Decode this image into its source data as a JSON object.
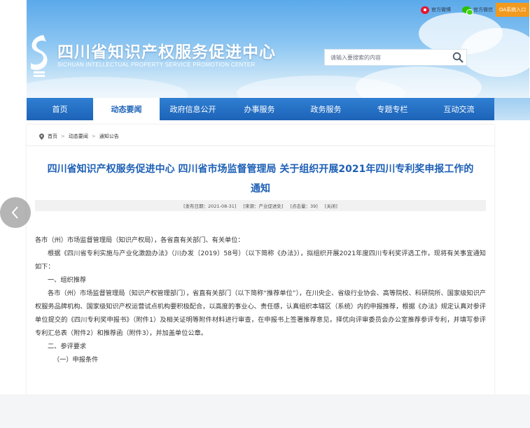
{
  "header": {
    "weibo_label": "官方微博",
    "wechat_label": "官方微信",
    "oa_label": "OA系统入口",
    "site_title": "四川省知识产权服务促进中心",
    "site_subtitle": "SICHUAN INTELLECTUAL PROPERTY SERVICE PROMOTION CENTER",
    "search_placeholder": "请输入要搜索的内容"
  },
  "nav": {
    "items": [
      {
        "label": "首页"
      },
      {
        "label": "动态要闻"
      },
      {
        "label": "政府信息公开"
      },
      {
        "label": "办事服务"
      },
      {
        "label": "政务服务"
      },
      {
        "label": "专题专栏"
      },
      {
        "label": "互动交流"
      }
    ],
    "active_index": 1
  },
  "breadcrumb": {
    "items": [
      "首页",
      "动态要闻",
      "通知公告"
    ],
    "separator": ">"
  },
  "article": {
    "title_line1": "四川省知识产权服务促进中心 四川省市场监督管理局 关于组织开展2021年四川专利奖申报工作的",
    "title_line2": "通知",
    "meta": {
      "date": "[发布日期：2021-08-31]",
      "source": "[来源：产业促进处]",
      "clicks": "[点击量：39]",
      "close": "[关闭]"
    },
    "paragraphs": [
      "各市（州）市场监督管理局（知识产权局），各省直有关部门、有关单位：",
      "根据《四川省专利实施与产业化激励办法》（川办发〔2019〕58号）（以下简称《办法》），拟组织开展2021年度四川专利奖评选工作，现将有关事宜通知如下：",
      "一、组织推荐",
      "各市（州）市场监督管理局（知识产权管理部门），省直有关部门（以下简称“推荐单位”），在川央企、省级行业协会、高等院校、科研院所、国家级知识产权服务品牌机构、国家级知识产权运营试点机构要积极配合，以高度的事业心、责任感，认真组织本辖区（系统）内的申报推荐，根据《办法》规定认真对参评单位提交的《四川专利奖申报书》（附件1）及相关证明等附件材料进行审查，在申报书上签署推荐意见，择优向评审委员会办公室推荐参评专利，并填写参评专利汇总表（附件2）和推荐函（附件3），并加盖单位公章。",
      "二、参评要求",
      "（一）申报条件"
    ]
  },
  "colors": {
    "nav_blue": "#1d63b8",
    "title_blue": "#1d5fb6",
    "oa_orange": "#f29a1f"
  }
}
